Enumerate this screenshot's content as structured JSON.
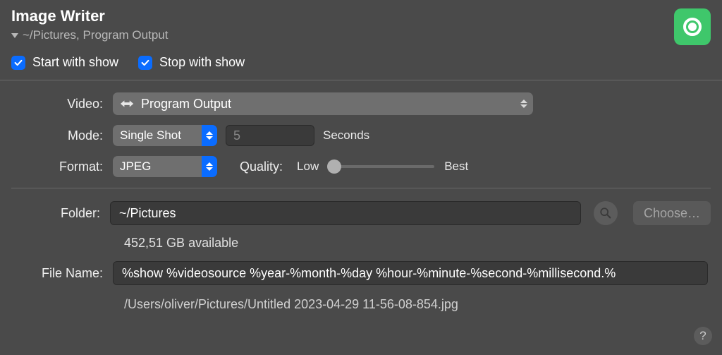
{
  "header": {
    "title": "Image Writer",
    "subtitle": "~/Pictures, Program Output"
  },
  "checks": {
    "start_label": "Start with show",
    "stop_label": "Stop with show"
  },
  "labels": {
    "video": "Video:",
    "mode": "Mode:",
    "format": "Format:",
    "seconds": "Seconds",
    "quality": "Quality:",
    "low": "Low",
    "best": "Best",
    "folder": "Folder:",
    "choose": "Choose…",
    "file_name": "File Name:"
  },
  "values": {
    "video": "Program Output",
    "mode": "Single Shot",
    "interval": "5",
    "format": "JPEG",
    "folder": "~/Pictures",
    "available": "452,51 GB available",
    "file_name_template": "%show %videosource %year-%month-%day %hour-%minute-%second-%millisecond.%",
    "preview_path": "/Users/oliver/Pictures/Untitled 2023-04-29 11-56-08-854.jpg"
  },
  "help": "?"
}
